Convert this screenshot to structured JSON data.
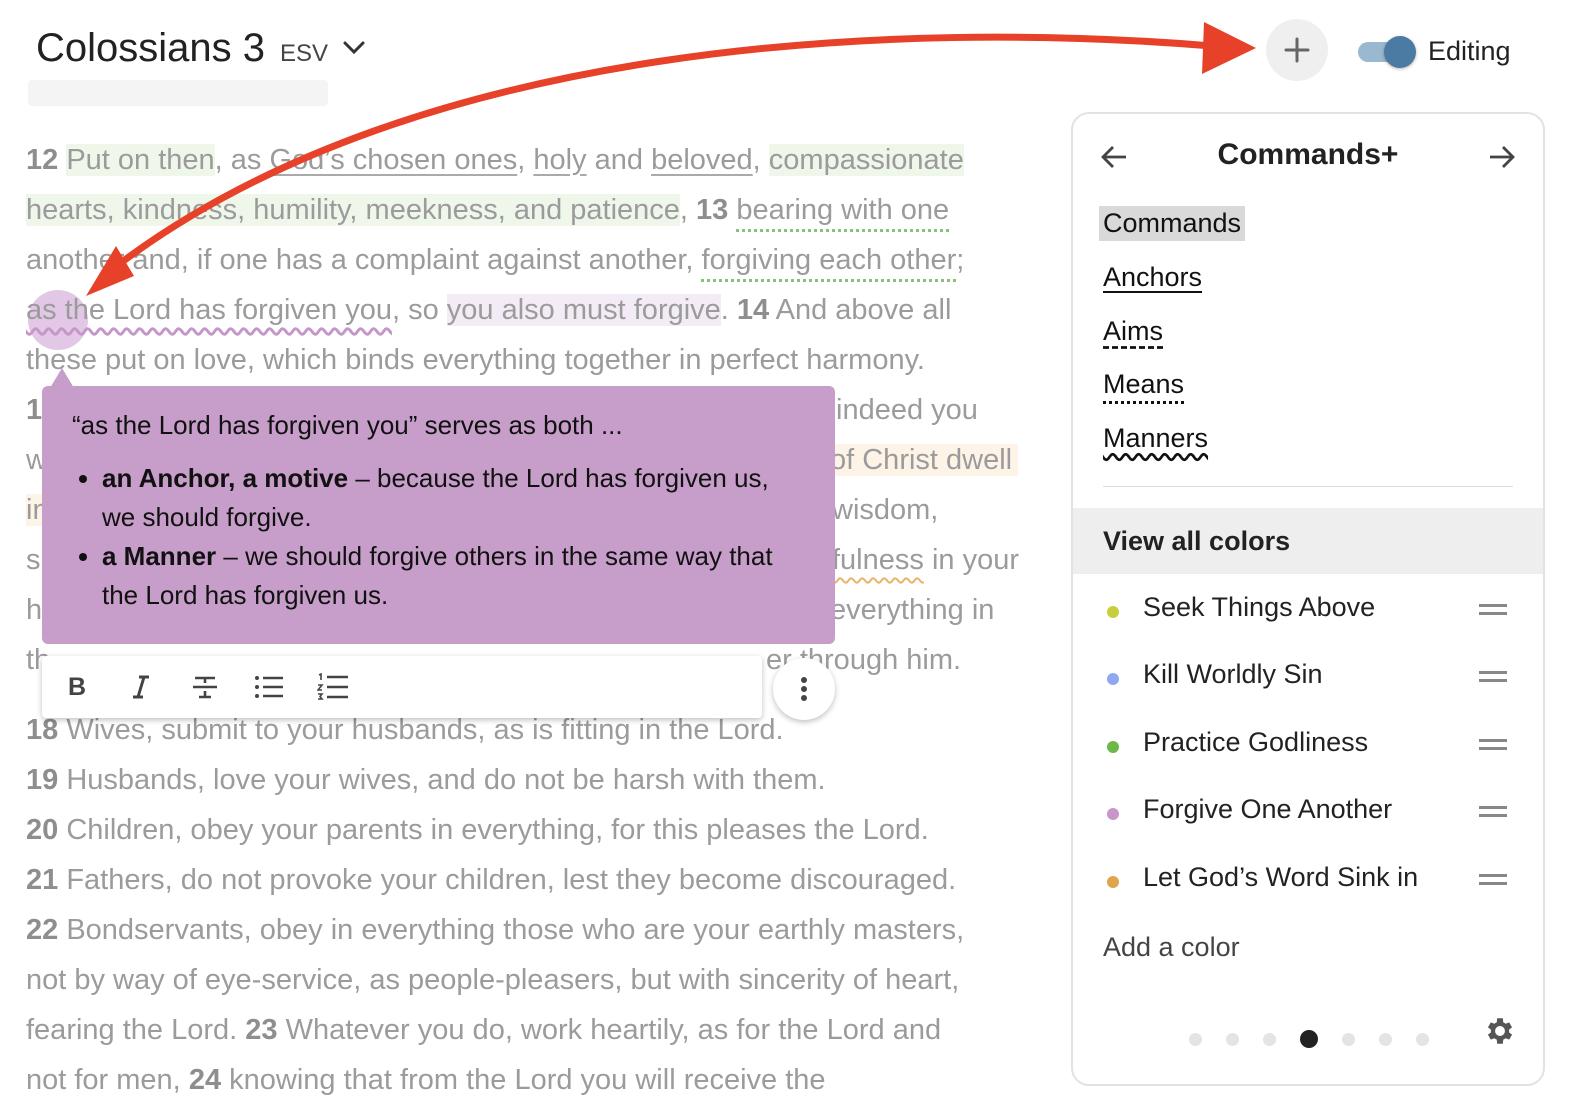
{
  "header": {
    "title": "Colossians 3",
    "version": "ESV",
    "editing_label": "Editing",
    "editing_on": true,
    "icons": {
      "add": "plus-icon",
      "dropdown": "chevron-down-icon"
    }
  },
  "passage": {
    "l1": {
      "n12": "12",
      "a": "Put on then",
      "b": ", as ",
      "c": "God’s chosen ones",
      "d": ", ",
      "e": "holy",
      "f": " and ",
      "g": "beloved",
      "h": ", ",
      "i": "compassionate"
    },
    "l2": {
      "a": "hearts, kindness, humility, meekness, and patience",
      "b": ", ",
      "n13": "13",
      "c": " ",
      "d": "bearing with one"
    },
    "l3": {
      "a": "another and, if one has a complaint against another, ",
      "b": "forgiving each other",
      "c": ";"
    },
    "l4": {
      "a": "as the Lord has forgiven you",
      "b": ", so ",
      "c": "you also must forgive",
      "d": ". ",
      "n14": "14",
      "e": " And above all"
    },
    "l5": {
      "a": "these put on love, which binds everything together in perfect harmony."
    },
    "l6": {
      "a": "1",
      "b": "indeed you"
    },
    "l7": {
      "a": "w",
      "b": "of Christ dwell"
    },
    "l8": {
      "a": "in",
      "b": "wisdom,"
    },
    "l9": {
      "a": "s",
      "b": "fulness",
      "c": " in your"
    },
    "l10": {
      "a": "h",
      "b": "everything in"
    },
    "l11": {
      "a": "th",
      "b": "er through him."
    },
    "v18": {
      "n": "18",
      "t": " Wives, submit to your husbands, as is fitting in the Lord."
    },
    "v19": {
      "n": "19",
      "t": " Husbands, love your wives, and do not be harsh with them."
    },
    "v20": {
      "n": "20",
      "t": " Children, obey your parents in everything, for this pleases the Lord."
    },
    "v21": {
      "n": "21",
      "t": " Fathers, do not provoke your children, lest they become discouraged."
    },
    "v22": {
      "n": "22",
      "t": " Bondservants, obey in everything those who are your earthly masters,"
    },
    "v22b": {
      "t": "not by way of eye-service, as people-pleasers, but with sincerity of heart,"
    },
    "v22c": {
      "t": "fearing the Lord. ",
      "n23": "23",
      "t2": " Whatever you do, work heartily, as for the Lord and"
    },
    "v24": {
      "t": "not for men, ",
      "n24": "24",
      "t2": " knowing that from the Lord you will receive the"
    }
  },
  "note": {
    "intro": "“as the Lord has forgiven you” serves as both ...",
    "items": [
      {
        "bold": "an Anchor, a motive",
        "text": " – because the Lord has forgiven us, we should forgive."
      },
      {
        "bold": "a Manner",
        "text": " – we should forgive others in the same way that the Lord has forgiven us."
      }
    ]
  },
  "toolbar": {
    "bold": "B",
    "icons": [
      "bold-icon",
      "italic-icon",
      "strikethrough-icon",
      "bulleted-list-icon",
      "numbered-list-icon",
      "more-vertical-icon"
    ]
  },
  "panel": {
    "title": "Commands+",
    "categories": [
      "Commands",
      "Anchors",
      "Aims",
      "Means",
      "Manners"
    ],
    "view_all": "View all colors",
    "colors": [
      {
        "label": "Seek Things Above",
        "color": "#c8cf3c"
      },
      {
        "label": "Kill Worldly Sin",
        "color": "#8fa8f0"
      },
      {
        "label": "Practice Godliness",
        "color": "#6cb84a"
      },
      {
        "label": "Forgive One Another",
        "color": "#c797c9"
      },
      {
        "label": "Let God’s Word Sink in",
        "color": "#e0a44a"
      }
    ],
    "add_color": "Add a color",
    "pager": {
      "pages": 7,
      "current": 4
    }
  }
}
